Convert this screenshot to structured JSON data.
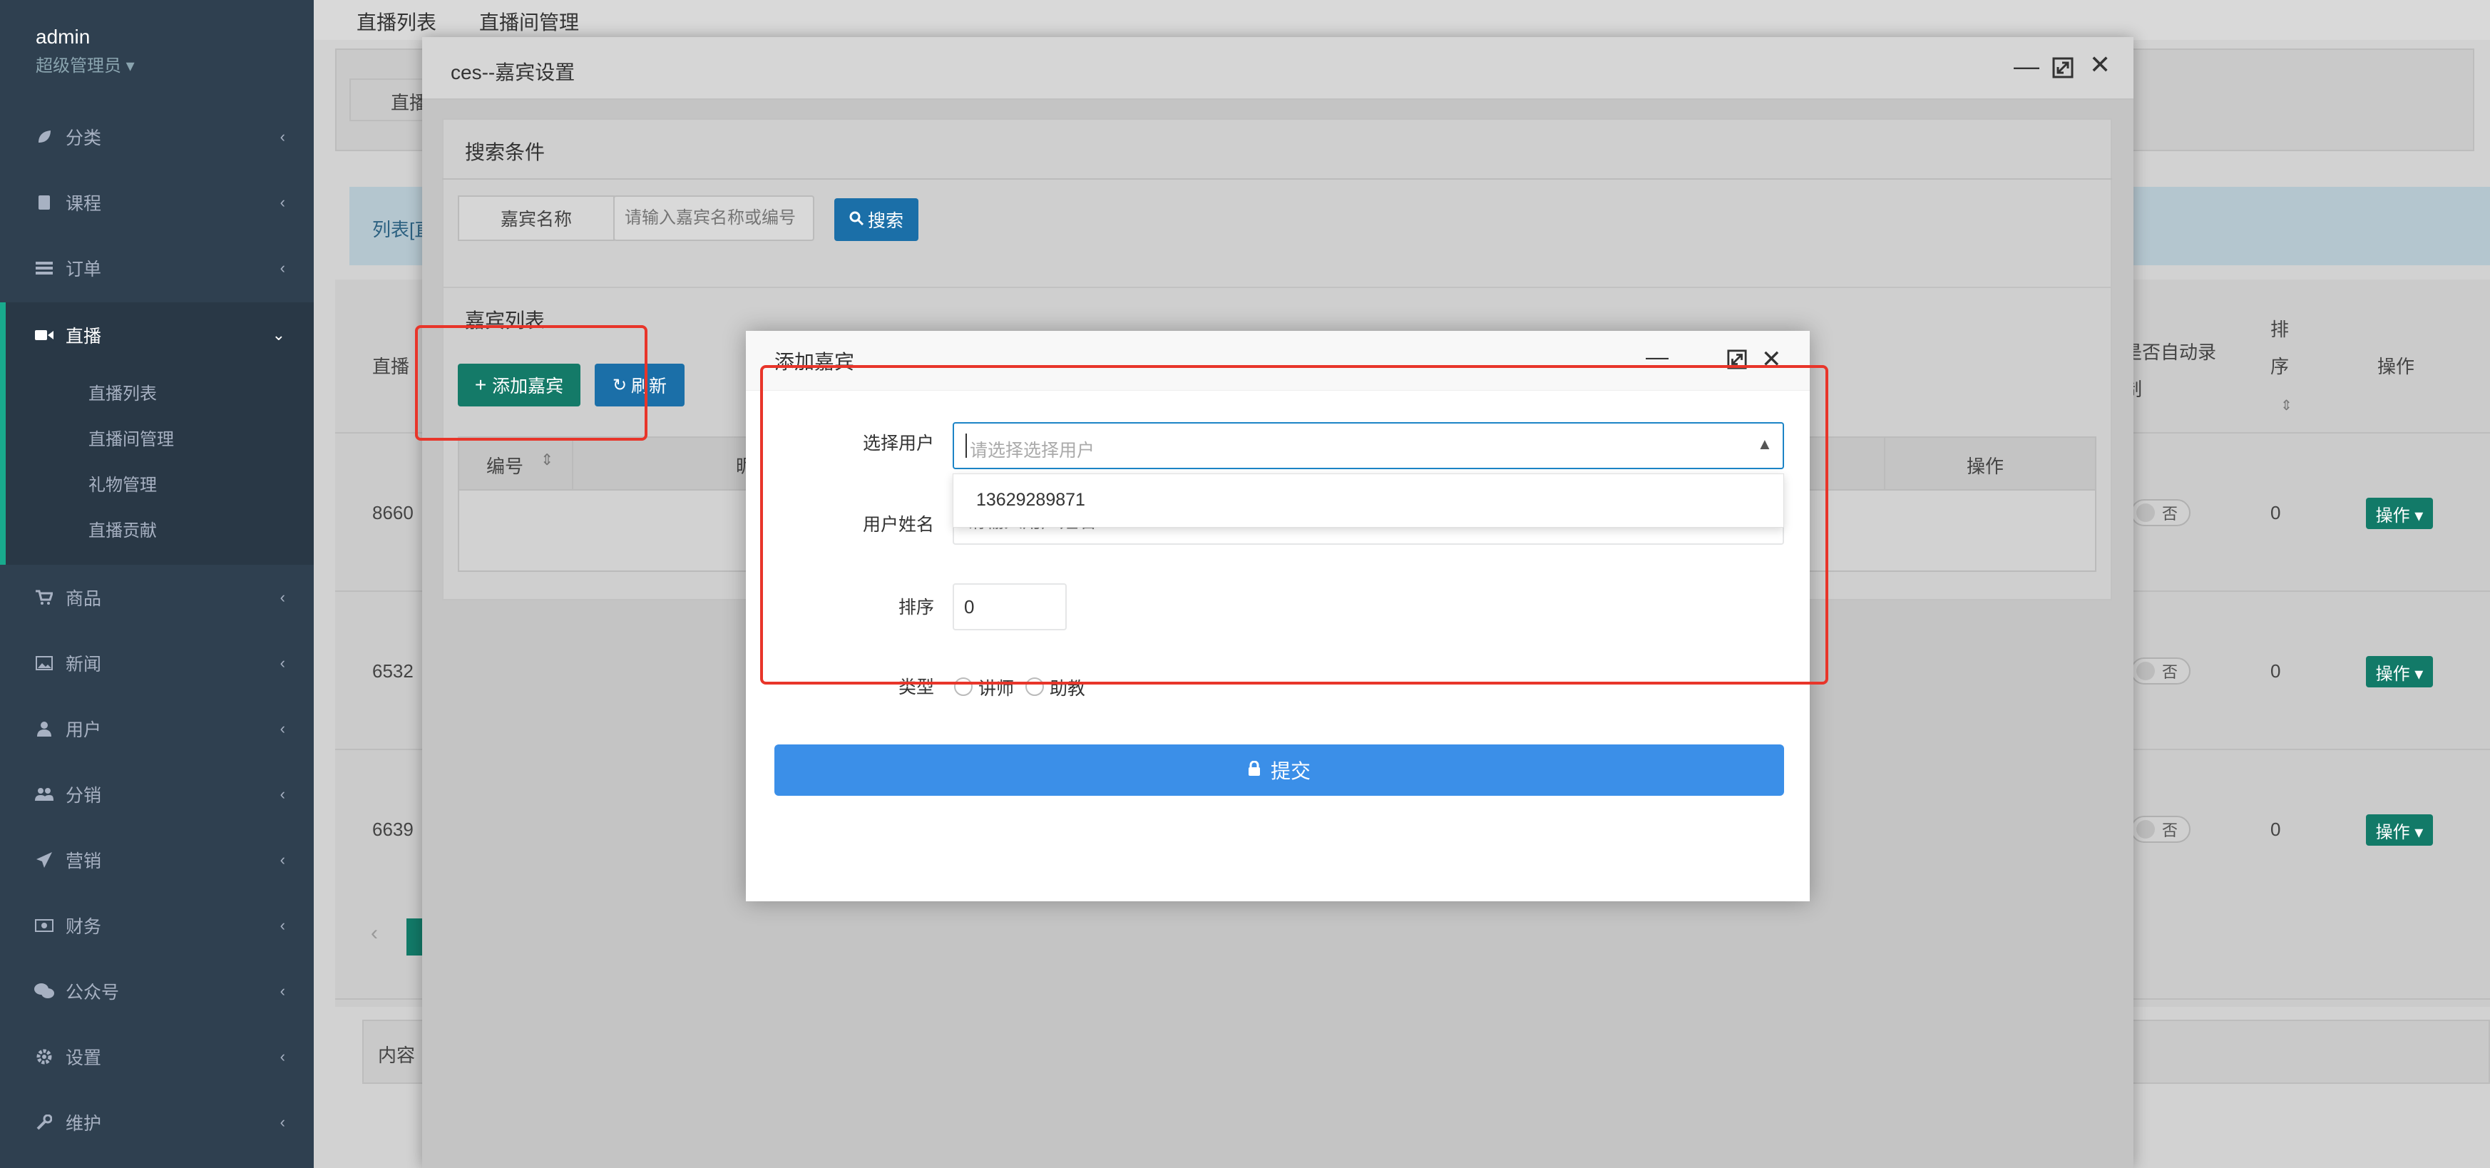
{
  "sidebar": {
    "user_name": "admin",
    "user_role": "超级管理员 ▾",
    "items": [
      {
        "label": "分类",
        "icon": "leaf-icon"
      },
      {
        "label": "课程",
        "icon": "book-icon"
      },
      {
        "label": "订单",
        "icon": "list-icon"
      },
      {
        "label": "直播",
        "icon": "video-camera-icon"
      },
      {
        "label": "商品",
        "icon": "cart-icon"
      },
      {
        "label": "新闻",
        "icon": "image-icon"
      },
      {
        "label": "用户",
        "icon": "user-icon"
      },
      {
        "label": "分销",
        "icon": "users-icon"
      },
      {
        "label": "营销",
        "icon": "send-icon"
      },
      {
        "label": "财务",
        "icon": "money-icon"
      },
      {
        "label": "公众号",
        "icon": "wechat-icon"
      },
      {
        "label": "设置",
        "icon": "gear-icon"
      },
      {
        "label": "维护",
        "icon": "wrench-icon"
      }
    ],
    "live_sub": [
      "直播列表",
      "直播间管理",
      "礼物管理",
      "直播贡献"
    ]
  },
  "page": {
    "tabs": [
      "直播列表",
      "直播间管理"
    ],
    "bg_tab_stub": "直播",
    "bg_alert": "列表[直",
    "bg_col": "直播",
    "bg_col_autorec": "是否自动录制",
    "bg_col_sort": "排序",
    "bg_col_ops": "操作",
    "rows": [
      {
        "id": "8660",
        "toggle": "否",
        "sort": "0",
        "op": "操作 ▾"
      },
      {
        "id": "6532",
        "toggle": "否",
        "sort": "0",
        "op": "操作 ▾"
      },
      {
        "id": "6639",
        "toggle": "否",
        "sort": "0",
        "op": "操作 ▾"
      }
    ],
    "bottom_label": "内容"
  },
  "outer_modal": {
    "title": "ces--嘉宾设置",
    "search_section": "搜索条件",
    "search_label": "嘉宾名称",
    "search_placeholder": "请输入嘉宾名称或编号",
    "search_button": "搜索",
    "list_section": "嘉宾列表",
    "add_button": "添加嘉宾",
    "refresh_button": "刷新",
    "col_id": "编号",
    "col_name": "昵",
    "col_ops": "操作"
  },
  "inner_modal": {
    "title": "添加嘉宾",
    "select_user_label": "选择用户",
    "select_user_placeholder": "请选择选择用户",
    "dropdown_option": "13629289871",
    "username_label": "用户姓名",
    "username_placeholder": "请输入用户姓名",
    "sort_label": "排序",
    "sort_value": "0",
    "type_label": "类型",
    "type_options": [
      "讲师",
      "助教"
    ],
    "submit": "提交"
  }
}
